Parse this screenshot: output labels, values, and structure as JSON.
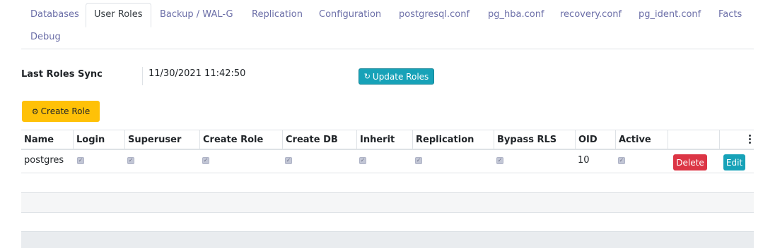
{
  "tabs": [
    {
      "label": "Databases"
    },
    {
      "label": "User Roles",
      "active": true
    },
    {
      "label": "Backup / WAL-G"
    },
    {
      "label": "Replication"
    },
    {
      "label": "Configuration"
    },
    {
      "label": "postgresql.conf"
    },
    {
      "label": "pg_hba.conf"
    },
    {
      "label": "recovery.conf"
    },
    {
      "label": "pg_ident.conf"
    },
    {
      "label": "Facts"
    },
    {
      "label": "Debug"
    }
  ],
  "sync": {
    "label": "Last Roles Sync",
    "value": "11/30/2021 11:42:50"
  },
  "buttons": {
    "update_roles": "Update Roles",
    "create_role": "Create Role",
    "delete": "Delete",
    "edit": "Edit"
  },
  "icons": {
    "update": "refresh-icon",
    "create": "gear-icon",
    "columns_menu": "vertical-dots-icon"
  },
  "table": {
    "columns": [
      "Name",
      "Login",
      "Superuser",
      "Create Role",
      "Create DB",
      "Inherit",
      "Replication",
      "Bypass RLS",
      "OID",
      "Active",
      ""
    ],
    "rows": [
      {
        "name": "postgres",
        "login": true,
        "superuser": true,
        "create_role": true,
        "create_db": true,
        "inherit": true,
        "replication": true,
        "bypass_rls": true,
        "oid": "10",
        "active": true
      }
    ]
  },
  "colors": {
    "tab_text": "#6c6fa8",
    "info": "#17a2b8",
    "warning": "#ffc107",
    "danger": "#dc3545"
  }
}
